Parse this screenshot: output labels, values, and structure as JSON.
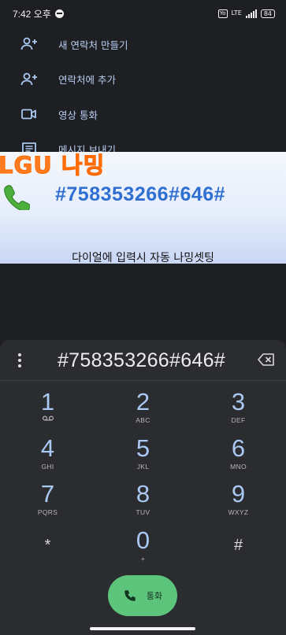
{
  "status_bar": {
    "time": "7:42 오후",
    "sim_badge": "Yo LTE",
    "network": "LTE",
    "battery": "84"
  },
  "menu": {
    "items": [
      {
        "label": "새 연락처 만들기",
        "icon": "add-contact-icon"
      },
      {
        "label": "연락처에 추가",
        "icon": "add-to-contact-icon"
      },
      {
        "label": "영상 통화",
        "icon": "video-call-icon"
      },
      {
        "label": "메시지 보내기",
        "icon": "message-icon"
      }
    ]
  },
  "banner": {
    "title": "LGU 나밍",
    "code": "#758353266#646#",
    "caption": "다이얼에 입력시 자동 나밍셋팅"
  },
  "dialer": {
    "number": "#758353266#646#",
    "keys": [
      [
        {
          "digit": "1",
          "letters": "voicemail"
        },
        {
          "digit": "2",
          "letters": "ABC"
        },
        {
          "digit": "3",
          "letters": "DEF"
        }
      ],
      [
        {
          "digit": "4",
          "letters": "GHI"
        },
        {
          "digit": "5",
          "letters": "JKL"
        },
        {
          "digit": "6",
          "letters": "MNO"
        }
      ],
      [
        {
          "digit": "7",
          "letters": "PQRS"
        },
        {
          "digit": "8",
          "letters": "TUV"
        },
        {
          "digit": "9",
          "letters": "WXYZ"
        }
      ],
      [
        {
          "digit": "*",
          "letters": ""
        },
        {
          "digit": "0",
          "letters": "+"
        },
        {
          "digit": "#",
          "letters": ""
        }
      ]
    ],
    "call_label": "통화"
  },
  "colors": {
    "accent_blue": "#a9c8f2",
    "call_green": "#5dc47c",
    "banner_orange": "#ff7b1f",
    "banner_code_blue": "#2f6fd1"
  }
}
